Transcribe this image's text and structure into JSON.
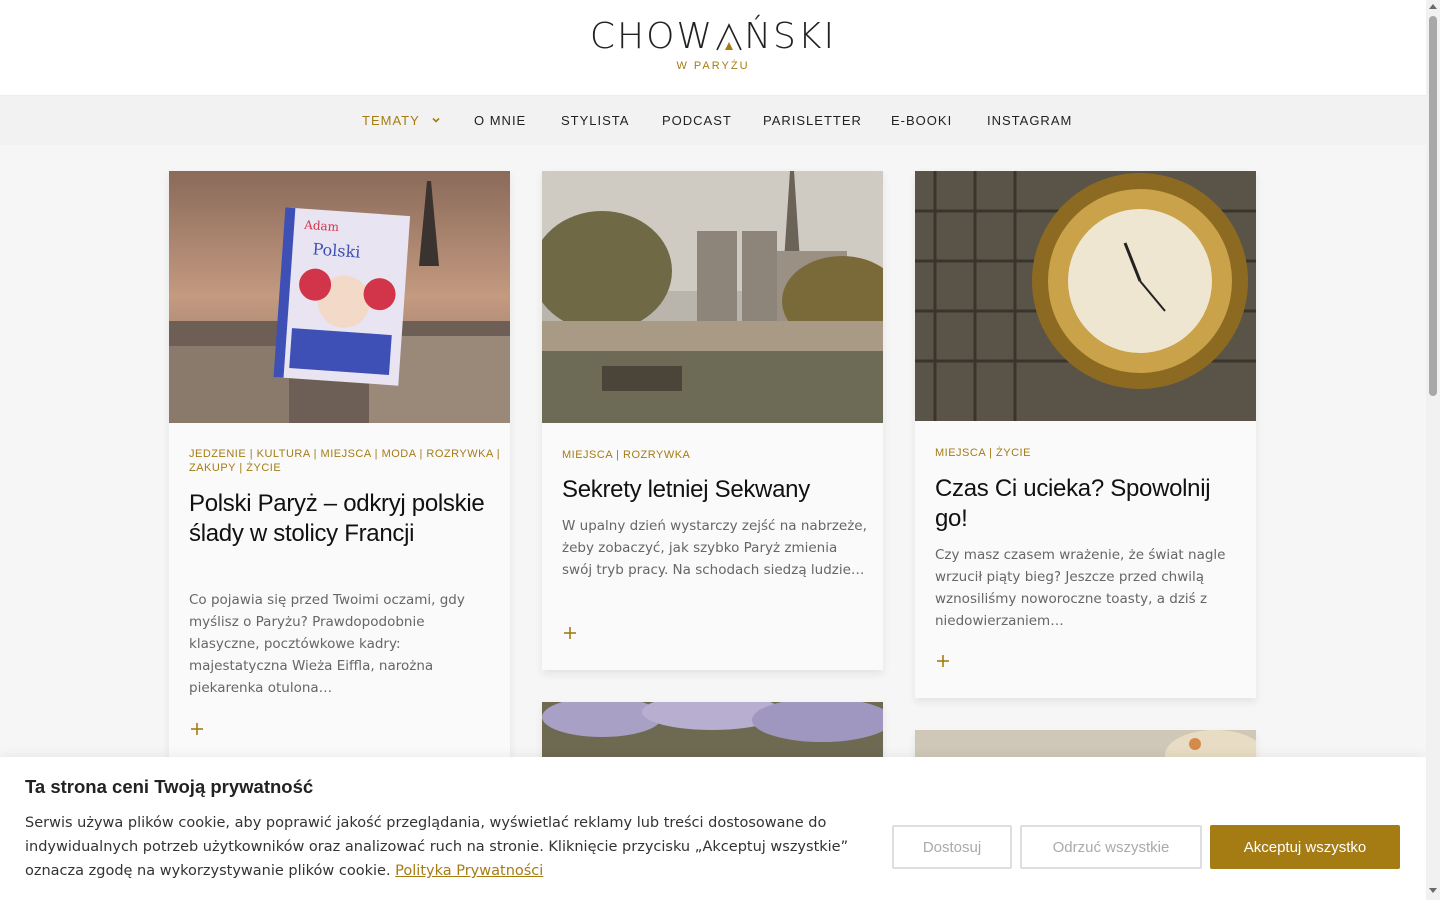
{
  "colors": {
    "accent": "#a57c14",
    "nav_bg": "#f2f2f2",
    "page_bg": "#f6f6f6"
  },
  "header": {
    "logo_left": "CHOW",
    "logo_right": "ŃSKI",
    "logo_sub": "W PARYŻU"
  },
  "nav": {
    "items": [
      {
        "label": "TEMATY",
        "has_dropdown": true,
        "active": true
      },
      {
        "label": "O MNIE"
      },
      {
        "label": "STYLISTA"
      },
      {
        "label": "PODCAST"
      },
      {
        "label": "PARISLETTER"
      },
      {
        "label": "E-BOOKI"
      },
      {
        "label": "INSTAGRAM"
      }
    ]
  },
  "posts": [
    {
      "categories_line1": "JEDZENIE | KULTURA | MIEJSCA | MODA | ROZRYWKA |",
      "categories_line2": "ZAKUPY | ŻYCIE",
      "title": "Polski Paryż – odkryj polskie ślady w stolicy Francji",
      "excerpt": "Co pojawia się przed Twoimi oczami, gdy myślisz o Paryżu? Prawdopodobnie klasyczne, pocztówkowe kadry: majestatyczna Wieża Eiffla, narożna piekarenka otulona…",
      "image": "book-cover-polski-paryz-over-paris-rooftops"
    },
    {
      "categories_line1": "MIEJSCA | ROZRYWKA",
      "title": "Sekrety letniej Sekwany",
      "excerpt": "W upalny dzień wystarczy zejść na nabrzeże, żeby zobaczyć, jak szybko Paryż zmienia swój tryb pracy. Na schodach siedzą ludzie…",
      "image": "notre-dame-and-seine-river"
    },
    {
      "categories_line1": "MIEJSCA | ŻYCIE",
      "title": "Czas Ci ucieka? Spowolnij go!",
      "excerpt": "Czy masz czasem wrażenie, że świat nagle wrzucił piąty bieg? Jeszcze przed chwilą wznosiliśmy noworoczne toasty, a dziś z niedowierzaniem…",
      "image": "musee-orsay-golden-clock"
    }
  ],
  "cookie": {
    "title": "Ta strona ceni Twoją prywatność",
    "text": "Serwis używa plików cookie, aby poprawić jakość przeglądania, wyświetlać reklamy lub treści dostosowane do indywidualnych potrzeb użytkowników oraz analizować ruch na stronie. Kliknięcie przycisku „Akceptuj wszystkie” oznacza zgodę na wykorzystywanie plików cookie.",
    "link": "Polityka Prywatności",
    "btn_customize": "Dostosuj",
    "btn_reject": "Odrzuć wszystkie",
    "btn_accept": "Akceptuj wszystko"
  }
}
